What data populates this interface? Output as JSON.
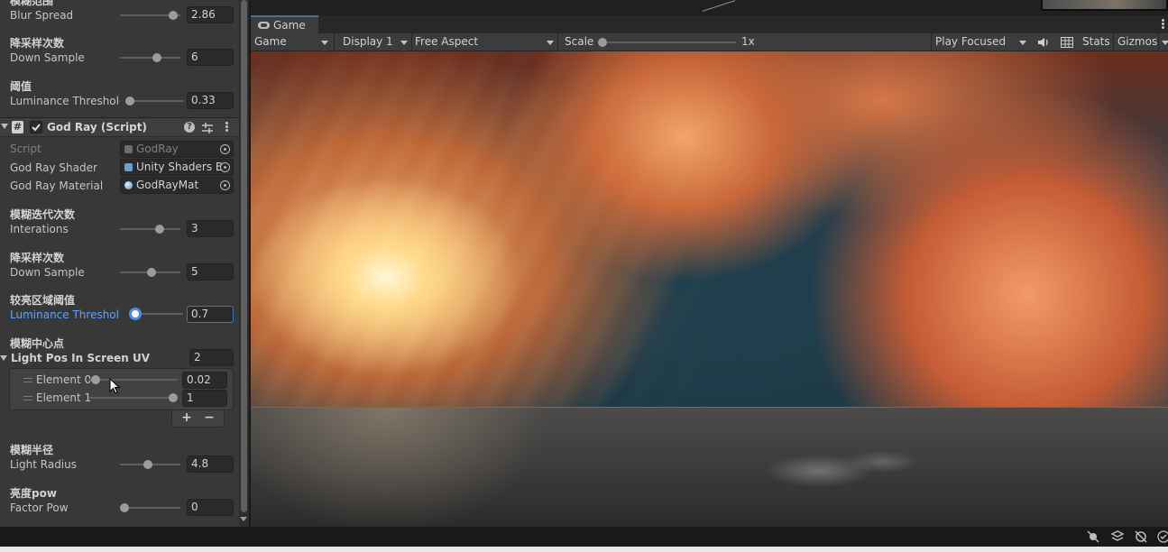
{
  "inspector": {
    "top_partial_heading": "模糊范围",
    "blur_spread": {
      "label": "Blur Spread",
      "value": "2.86",
      "fraction": 0.95
    },
    "down_sample_1": {
      "heading": "降采样次数",
      "label": "Down Sample",
      "value": "6",
      "fraction": 0.64
    },
    "luminance_1": {
      "heading": "阈值",
      "label": "Luminance Thresholc",
      "value": "0.33",
      "fraction": 0.0
    },
    "component": {
      "title": "God Ray (Script)",
      "icon": "script-hash-icon"
    },
    "script_field": {
      "label": "Script",
      "value": "GodRay"
    },
    "shader_field": {
      "label": "God Ray Shader",
      "value": "Unity Shaders B"
    },
    "material_field": {
      "label": "God Ray Material",
      "value": "GodRayMat"
    },
    "iterations": {
      "heading": "模糊迭代次数",
      "label": "Interations",
      "value": "3",
      "fraction": 0.68
    },
    "down_sample_2": {
      "heading": "降采样次数",
      "label": "Down Sample",
      "value": "5",
      "fraction": 0.53
    },
    "luminance_2": {
      "heading": "较亮区域阈值",
      "label": "Luminance Thresholc",
      "value": "0.7",
      "fraction": 0.0
    },
    "light_pos": {
      "heading": "模糊中心点",
      "label": "Light Pos In Screen UV",
      "size": "2",
      "elements": [
        {
          "label": "Element 0",
          "value": "0.02",
          "fraction": 0.02
        },
        {
          "label": "Element 1",
          "value": "1",
          "fraction": 1.0
        }
      ],
      "add": "+",
      "remove": "−"
    },
    "light_radius": {
      "heading": "模糊半径",
      "label": "Light Radius",
      "value": "4.8",
      "fraction": 0.45
    },
    "factor_pow": {
      "heading": "亮度pow",
      "label": "Factor Pow",
      "value": "0",
      "fraction": 0.0
    }
  },
  "game": {
    "tab_label": "Game",
    "toolbar": {
      "mode": "Game",
      "display": "Display 1",
      "aspect": "Free Aspect",
      "scale_label": "Scale",
      "scale_value": "1x",
      "play_mode": "Play Focused",
      "stats": "Stats",
      "gizmos": "Gizmos"
    }
  }
}
